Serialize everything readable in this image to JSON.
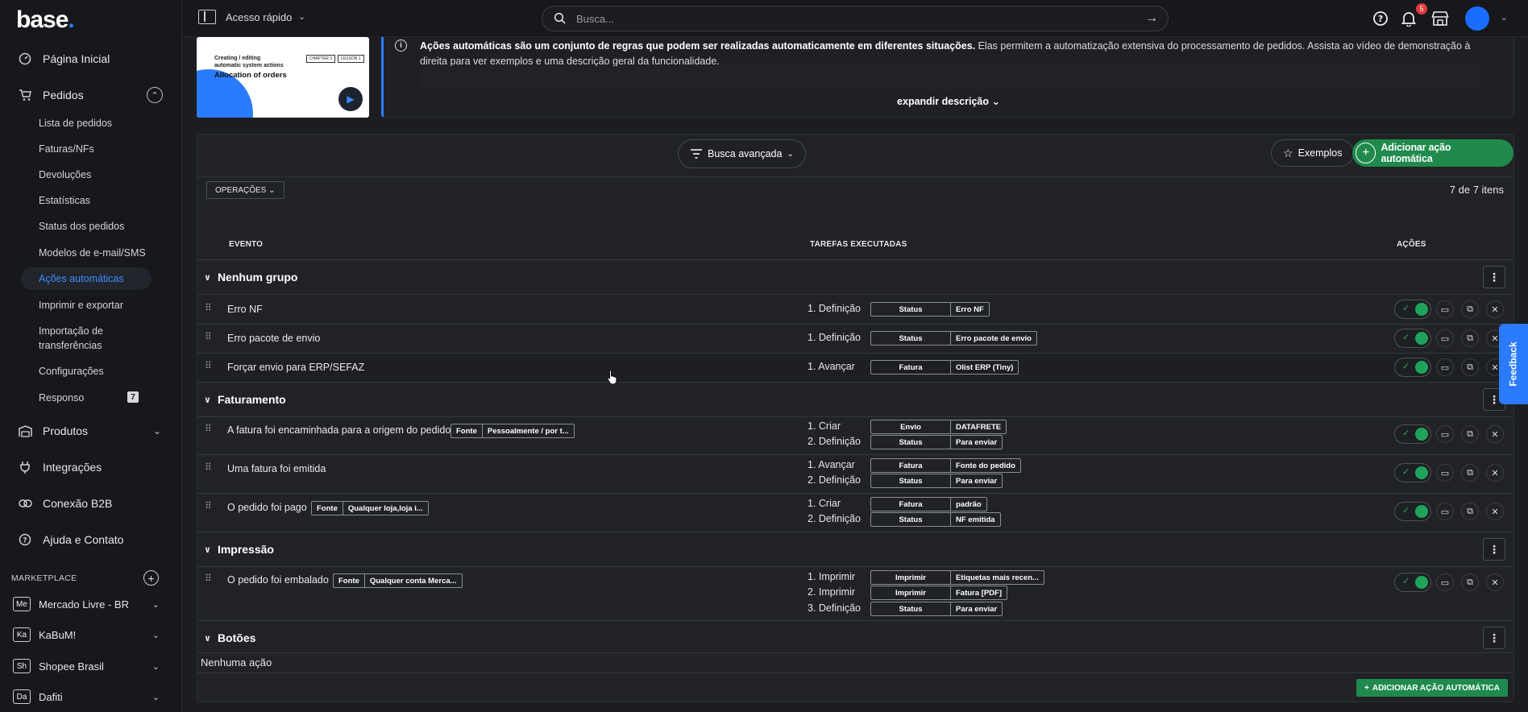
{
  "brand": {
    "name": "base",
    "dot": ".",
    "accent": "#2b7bff"
  },
  "sidebar": {
    "main": [
      {
        "label": "Página Inicial",
        "icon": "dashboard-icon"
      },
      {
        "label": "Pedidos",
        "icon": "cart-icon"
      },
      {
        "label": "Produtos",
        "icon": "warehouse-icon"
      },
      {
        "label": "Integrações",
        "icon": "plug-icon"
      },
      {
        "label": "Conexão B2B",
        "icon": "link-icon"
      },
      {
        "label": "Ajuda e Contato",
        "icon": "help-icon"
      }
    ],
    "sub": [
      "Lista de pedidos",
      "Faturas/NFs",
      "Devoluções",
      "Estatísticas",
      "Status dos pedidos",
      "Modelos de e-mail/SMS",
      "Ações automáticas",
      "Imprimir e exportar",
      "Importação de transferências",
      "Configurações",
      "Responso"
    ],
    "responso_badge": "7",
    "marketplace_label": "MARKETPLACE",
    "marketplaces": [
      {
        "abbr": "Me",
        "name": "Mercado Livre - BR"
      },
      {
        "abbr": "Ka",
        "name": "KaBuM!"
      },
      {
        "abbr": "Sh",
        "name": "Shopee Brasil"
      },
      {
        "abbr": "Da",
        "name": "Dafiti"
      }
    ]
  },
  "topbar": {
    "quick_access": "Acesso rápido",
    "search_placeholder": "Busca...",
    "notif_count": "5"
  },
  "info": {
    "video": {
      "line1": "Creating / editing",
      "line2": "automatic system actions",
      "title": "Allocation of orders",
      "chapter": "CHAPTER 3",
      "lesson": "LESSON 1"
    },
    "bold": "Ações automáticas são um conjunto de regras que podem ser realizadas automaticamente em diferentes situações.",
    "text": " Elas permitem a automatização extensiva do processamento de pedidos. Assista ao vídeo de demonstração à direita para ver exemplos e uma descrição geral da funcionalidade.",
    "expand": "expandir descrição"
  },
  "toolbar": {
    "advanced_search": "Busca avançada",
    "examples": "Exemplos",
    "add": "Adicionar ação automática",
    "operations": "OPERAÇÕES",
    "count": "7 de 7 itens"
  },
  "columns": {
    "event": "EVENTO",
    "tasks": "TAREFAS EXECUTADAS",
    "actions": "AÇÕES"
  },
  "groups": [
    {
      "name": "Nenhum grupo"
    },
    {
      "name": "Faturamento"
    },
    {
      "name": "Impressão"
    },
    {
      "name": "Botões"
    }
  ],
  "rows": [
    {
      "event": "Erro NF",
      "tasks": [
        {
          "label": "1. Definição",
          "k": "Status",
          "v": "Erro NF"
        }
      ]
    },
    {
      "event": "Erro pacote de envio",
      "tasks": [
        {
          "label": "1. Definição",
          "k": "Status",
          "v": "Erro pacote de envio"
        }
      ]
    },
    {
      "event": "Forçar envio para ERP/SEFAZ",
      "tasks": [
        {
          "label": "1. Avançar",
          "k": "Fatura",
          "v": "Olist ERP (Tiny)"
        }
      ]
    },
    {
      "event": "A fatura foi encaminhada para a origem do pedido",
      "chip": {
        "k": "Fonte",
        "v": "Pessoalmente / por t..."
      },
      "tasks": [
        {
          "label": "1. Criar",
          "k": "Envio",
          "v": "DATAFRETE"
        },
        {
          "label": "2. Definição",
          "k": "Status",
          "v": "Para enviar"
        }
      ]
    },
    {
      "event": "Uma fatura foi emitida",
      "tasks": [
        {
          "label": "1. Avançar",
          "k": "Fatura",
          "v": "Fonte do pedido"
        },
        {
          "label": "2. Definição",
          "k": "Status",
          "v": "Para enviar"
        }
      ]
    },
    {
      "event": "O pedido foi pago",
      "chip": {
        "k": "Fonte",
        "v": "Qualquer loja,loja i..."
      },
      "tasks": [
        {
          "label": "1. Criar",
          "k": "Fatura",
          "v": "padrão"
        },
        {
          "label": "2. Definição",
          "k": "Status",
          "v": "NF emitida"
        }
      ]
    },
    {
      "event": "O pedido foi embalado",
      "chip": {
        "k": "Fonte",
        "v": "Qualquer conta Merca..."
      },
      "tasks": [
        {
          "label": "1. Imprimir",
          "k": "Imprimir",
          "v": "Etiquetas mais recen..."
        },
        {
          "label": "2. Imprimir",
          "k": "Imprimir",
          "v": "Fatura [PDF]"
        },
        {
          "label": "3. Definição",
          "k": "Status",
          "v": "Para enviar"
        }
      ]
    }
  ],
  "empty_group_text": "Nenhuma ação",
  "add_bottom": "ADICIONAR AÇÃO AUTOMÁTICA",
  "feedback": "Feedback"
}
